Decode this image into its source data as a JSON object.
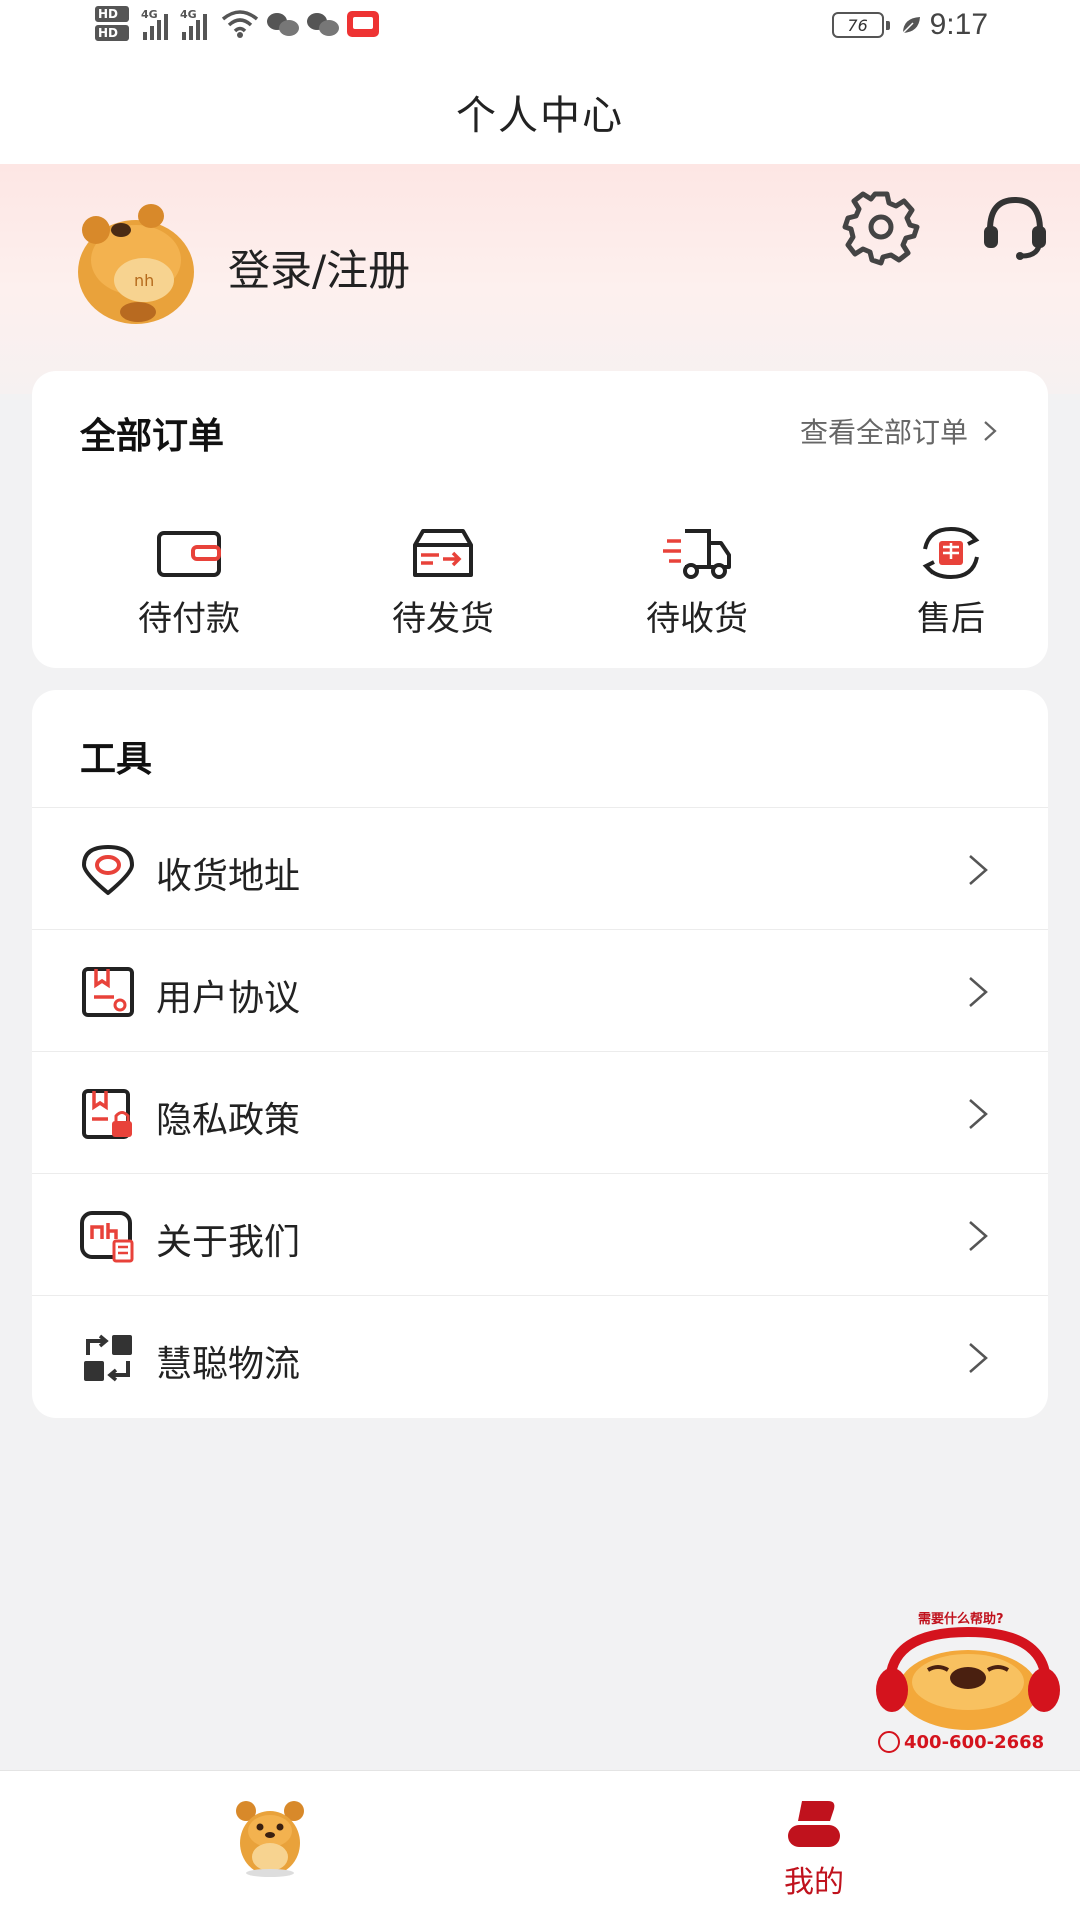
{
  "status_bar": {
    "hd1": "HD",
    "hd2": "HD",
    "net1": "4G",
    "net2": "4G",
    "battery": "76",
    "time": "9:17"
  },
  "nav": {
    "title": "个人中心"
  },
  "profile": {
    "login_label": "登录/注册",
    "settings_icon": "gear-icon",
    "service_icon": "headset-icon"
  },
  "orders": {
    "title": "全部订单",
    "view_all": "查看全部订单",
    "items": [
      {
        "label": "待付款",
        "icon": "wallet-icon"
      },
      {
        "label": "待发货",
        "icon": "shipping-box-icon"
      },
      {
        "label": "待收货",
        "icon": "delivery-truck-icon"
      },
      {
        "label": "售后",
        "icon": "after-sales-icon"
      }
    ]
  },
  "tools": {
    "title": "工具",
    "items": [
      {
        "label": "收货地址",
        "icon": "location-pin-icon"
      },
      {
        "label": "用户协议",
        "icon": "agreement-icon"
      },
      {
        "label": "隐私政策",
        "icon": "privacy-lock-icon"
      },
      {
        "label": "关于我们",
        "icon": "about-icon"
      },
      {
        "label": "慧聪物流",
        "icon": "logistics-icon"
      }
    ]
  },
  "help": {
    "prompt": "需要什么帮助?",
    "phone": "400-600-2668"
  },
  "tabbar": {
    "mine_label": "我的"
  },
  "colors": {
    "accent": "#c0121d",
    "icon_red": "#e8423a",
    "profile_bg": "#fde6e4",
    "page_bg": "#f2f2f3"
  }
}
